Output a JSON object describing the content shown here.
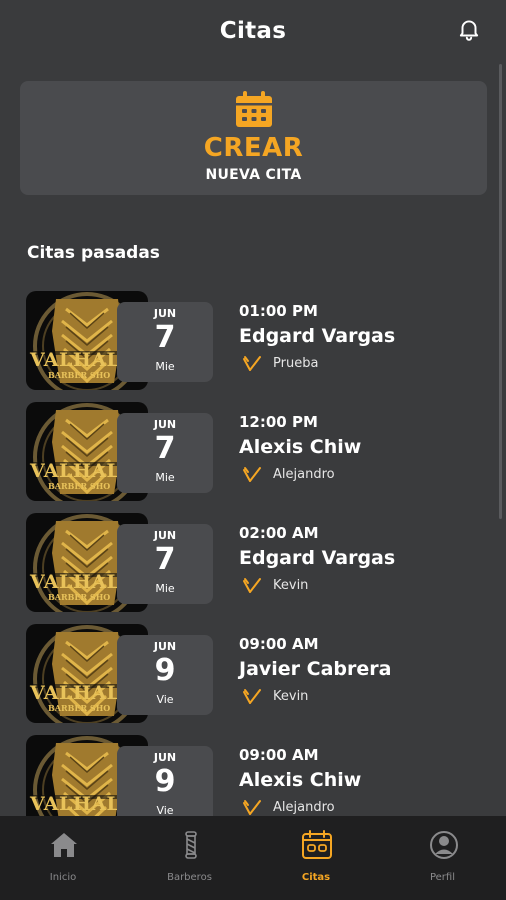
{
  "header": {
    "title": "Citas",
    "bell_icon": "bell-icon"
  },
  "create": {
    "title": "CREAR",
    "subtitle": "NUEVA CITA",
    "icon": "calendar-icon",
    "accent": "#f5a623"
  },
  "section_title": "Citas pasadas",
  "logo_text": {
    "line1": "VALHALI",
    "line2": "BARBER SHO"
  },
  "appointments": [
    {
      "month": "JUN",
      "day": "7",
      "weekday": "Mie",
      "time": "01:00 PM",
      "client": "Edgard Vargas",
      "barber": "Prueba"
    },
    {
      "month": "JUN",
      "day": "7",
      "weekday": "Mie",
      "time": "12:00 PM",
      "client": "Alexis Chiw",
      "barber": "Alejandro"
    },
    {
      "month": "JUN",
      "day": "7",
      "weekday": "Mie",
      "time": "02:00 AM",
      "client": "Edgard Vargas",
      "barber": "Kevin"
    },
    {
      "month": "JUN",
      "day": "9",
      "weekday": "Vie",
      "time": "09:00 AM",
      "client": "Javier Cabrera",
      "barber": "Kevin"
    },
    {
      "month": "JUN",
      "day": "9",
      "weekday": "Vie",
      "time": "09:00 AM",
      "client": "Alexis Chiw",
      "barber": "Alejandro"
    }
  ],
  "nav": [
    {
      "label": "Inicio",
      "icon": "home-icon",
      "active": false
    },
    {
      "label": "Barberos",
      "icon": "barber-pole-icon",
      "active": false
    },
    {
      "label": "Citas",
      "icon": "calendar-icon",
      "active": true
    },
    {
      "label": "Perfil",
      "icon": "user-icon",
      "active": false
    }
  ]
}
